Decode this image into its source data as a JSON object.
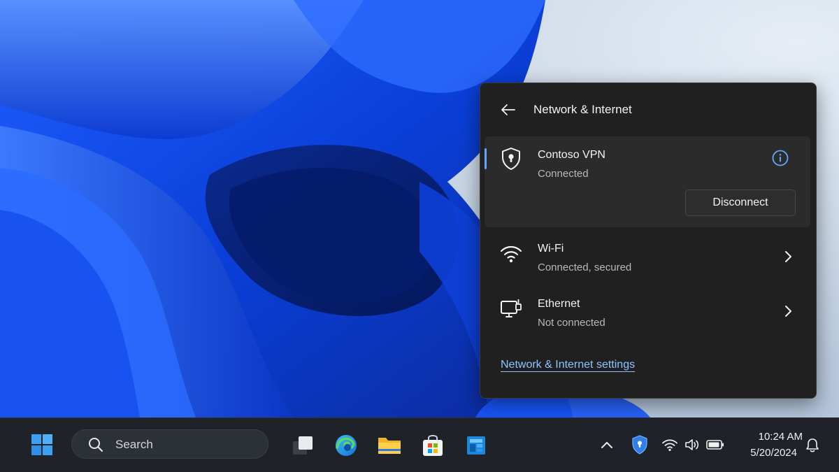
{
  "flyout": {
    "title": "Network & Internet",
    "vpn": {
      "name": "Contoso VPN",
      "status": "Connected",
      "disconnect_label": "Disconnect"
    },
    "connections": [
      {
        "name": "Wi-Fi",
        "status": "Connected, secured",
        "icon": "wifi-icon"
      },
      {
        "name": "Ethernet",
        "status": "Not connected",
        "icon": "ethernet-icon"
      }
    ],
    "settings_link": "Network & Internet settings"
  },
  "taskbar": {
    "search_placeholder": "Search",
    "pinned_apps": [
      "task-view-icon",
      "edge-icon",
      "file-explorer-icon",
      "store-icon",
      "widgets-icon"
    ],
    "tray": [
      "chevron-up-icon",
      "vpn-shield-icon",
      "wifi-icon",
      "volume-icon",
      "battery-icon"
    ],
    "time": "10:24 AM",
    "date": "5/20/2024"
  },
  "colors": {
    "accent": "#60a8ff",
    "panel_bg": "#202020",
    "card_bg": "#2b2b2b",
    "taskbar_bg": "#1f2329",
    "link": "#8fc3ff"
  }
}
